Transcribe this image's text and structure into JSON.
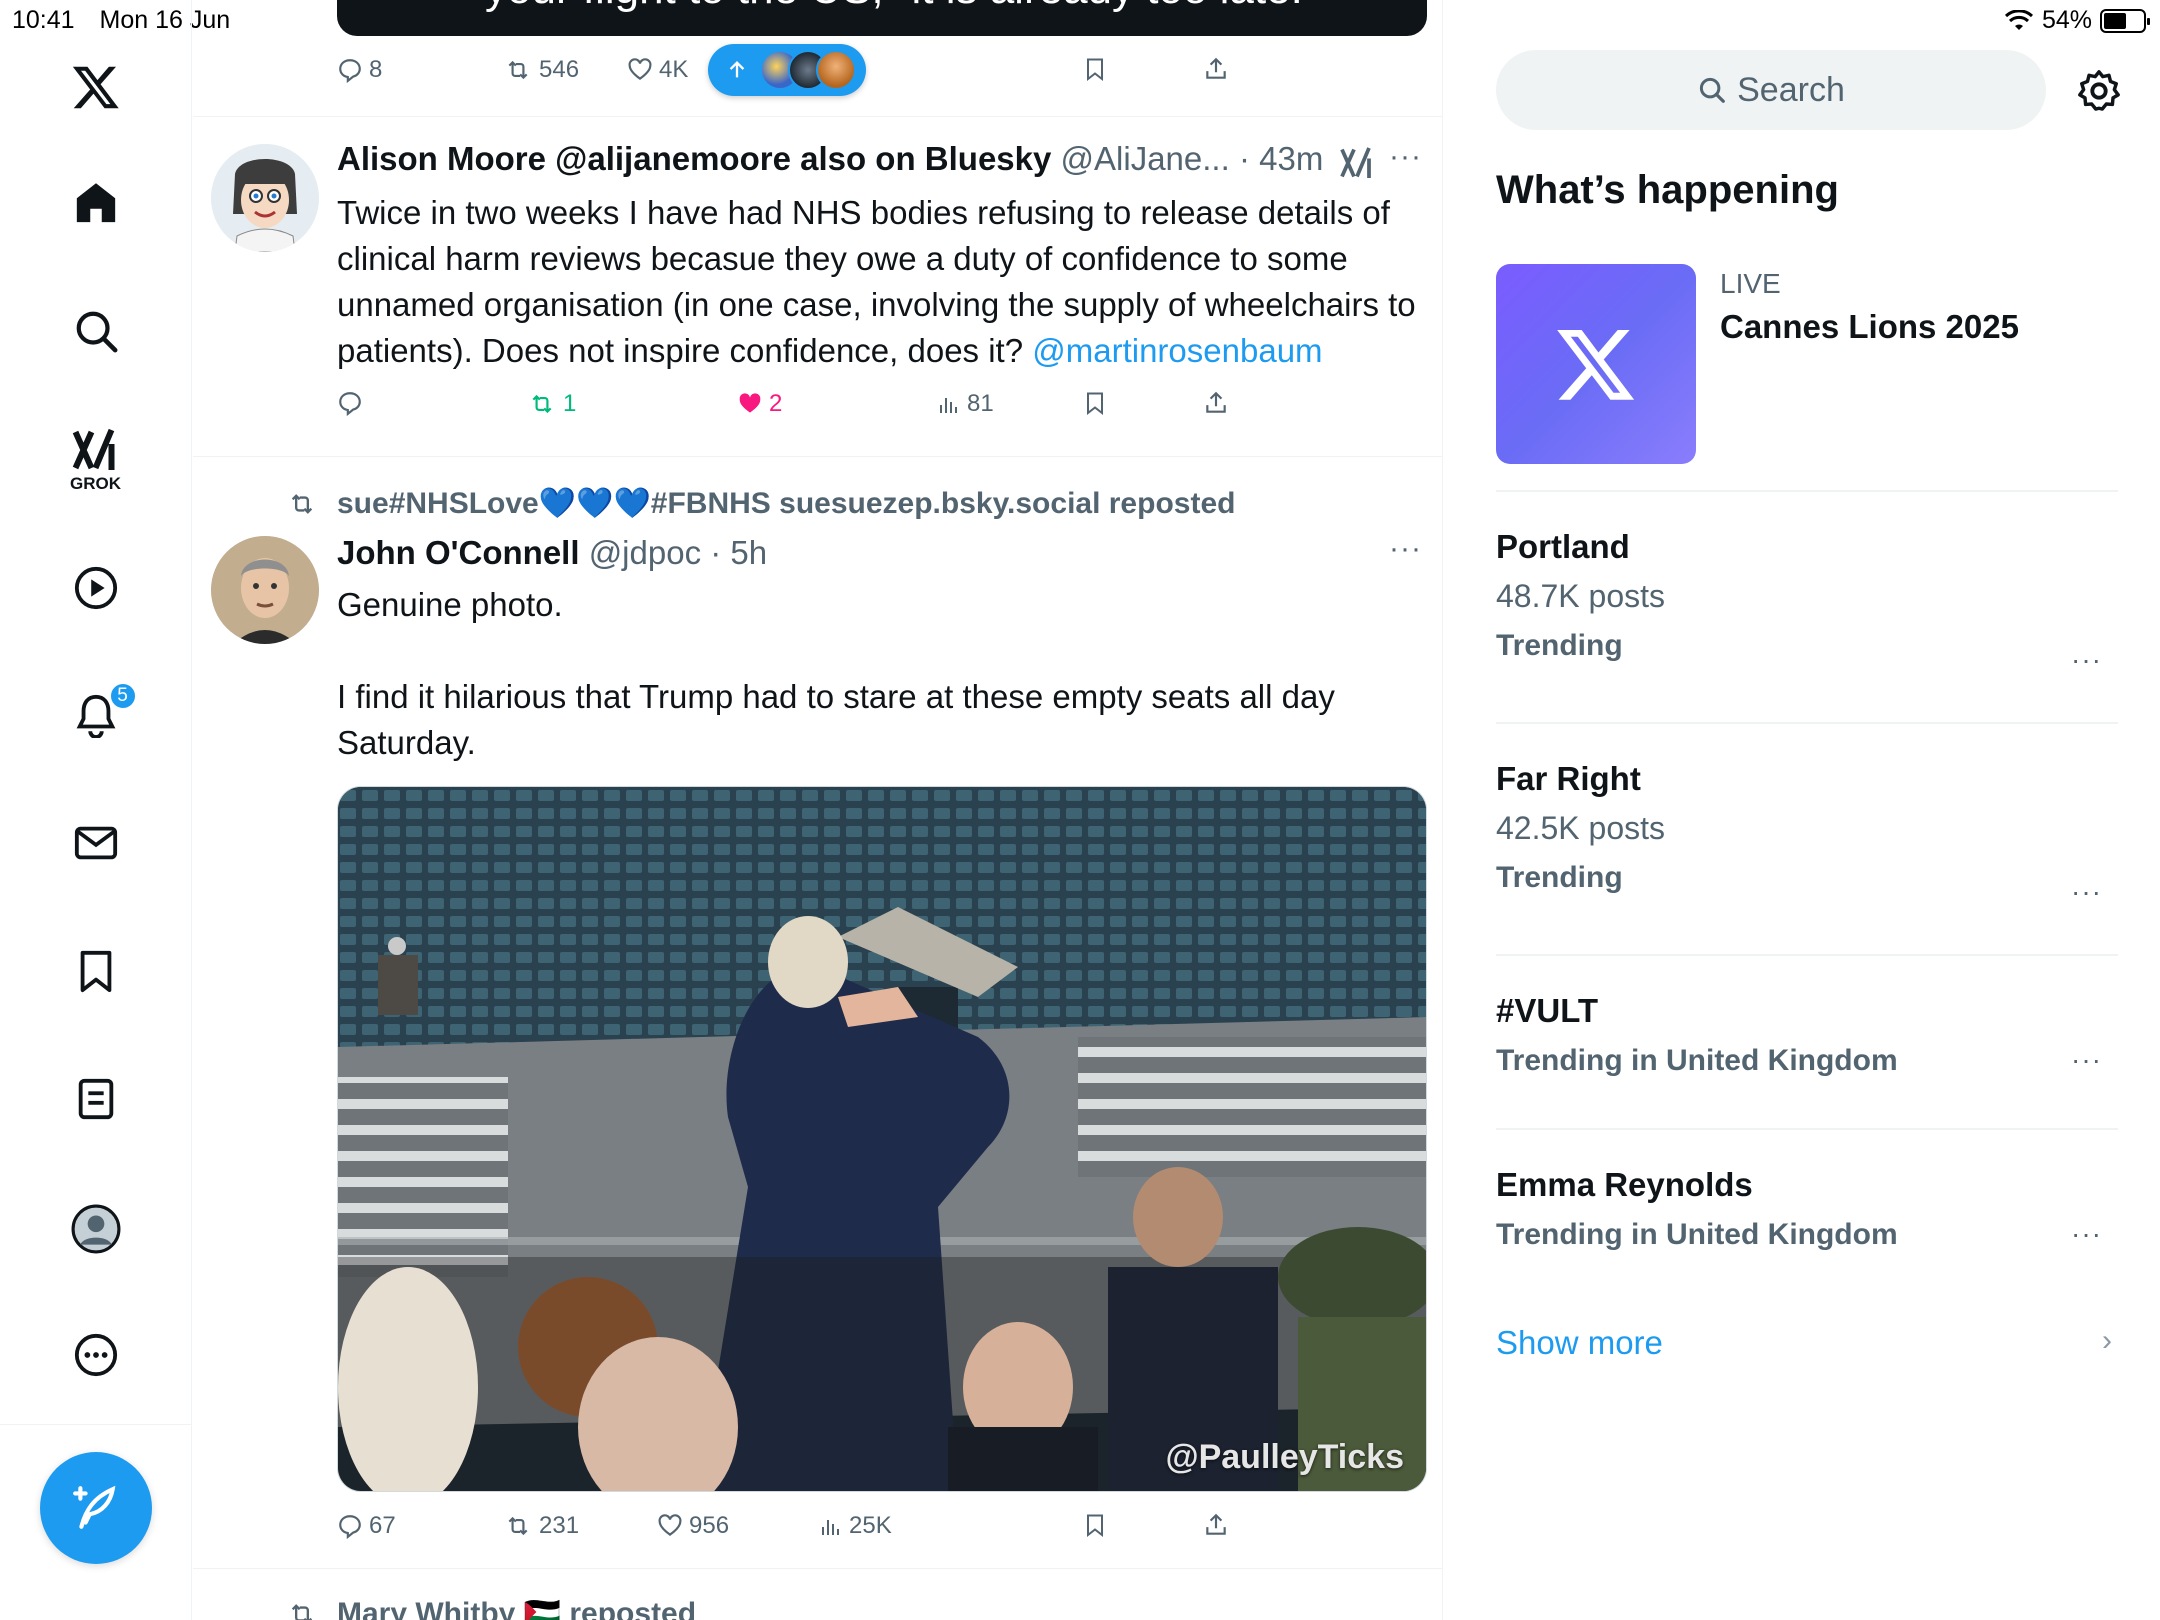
{
  "status_bar": {
    "time": "10:41",
    "date": "Mon 16 Jun",
    "battery": "54%"
  },
  "nav": {
    "grok_label": "GROK",
    "notification_count": "5",
    "items": [
      "x-logo",
      "home-icon",
      "search-icon",
      "grok-icon",
      "video-icon",
      "notifications-icon",
      "messages-icon",
      "bookmarks-icon",
      "lists-icon",
      "profile-icon",
      "more-icon"
    ]
  },
  "feed": {
    "top_remnant_text": "your flight to the US, \"it is already too late.\"",
    "prev_tweet_actions": {
      "replies": "8",
      "reposts": "546",
      "likes": "4K"
    },
    "tweet1": {
      "name": "Alison Moore @alijanemoore also on Bluesky",
      "handle": "@AliJane...",
      "time": "43m",
      "text": "Twice in two weeks I have had NHS bodies refusing to release details of clinical harm reviews becasue they owe a duty of confidence to some unnamed organisation (in one case, involving the supply of wheelchairs to patients). Does not inspire confidence, does it?",
      "mention": "@martinrosenbaum",
      "replies": "",
      "reposts": "1",
      "likes": "2",
      "views": "81"
    },
    "tweet2": {
      "repost_by": "sue#NHSLove💙💙💙#FBNHS suesuezep.bsky.social reposted",
      "name": "John O'Connell",
      "handle": "@jdpoc",
      "time": "5h",
      "text_line1": "Genuine photo.",
      "text_line2": "I find it hilarious that Trump had to stare at these empty seats all day Saturday.",
      "watermark": "@PaulleyTicks",
      "replies": "67",
      "reposts": "231",
      "likes": "956",
      "views": "25K"
    },
    "next_repost_peek": "Mary Whitby 🇵🇸 reposted"
  },
  "sidebar": {
    "search_placeholder": "Search",
    "whats_happening": "What’s happening",
    "live": {
      "label": "LIVE",
      "title": "Cannes Lions 2025"
    },
    "trends": [
      {
        "name": "Portland",
        "posts": "48.7K posts",
        "meta": "Trending"
      },
      {
        "name": "Far Right",
        "posts": "42.5K posts",
        "meta": "Trending"
      },
      {
        "name": "#VULT",
        "posts": "",
        "meta": "Trending in United Kingdom"
      },
      {
        "name": "Emma Reynolds",
        "posts": "",
        "meta": "Trending in United Kingdom"
      }
    ],
    "show_more": "Show more"
  },
  "colors": {
    "accent": "#1d9bf0",
    "like": "#f91880",
    "repost": "#00ba7c",
    "text": "#0f1419",
    "muted": "#536471"
  }
}
